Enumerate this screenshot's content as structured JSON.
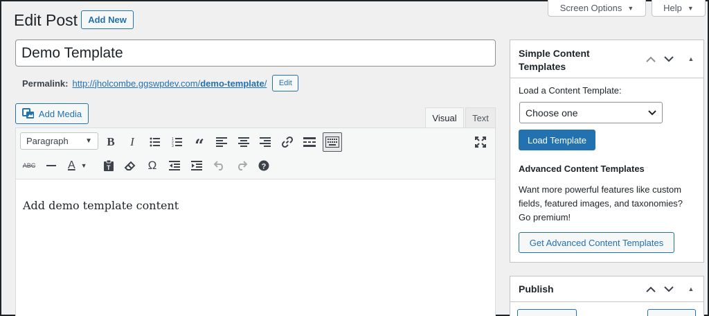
{
  "header": {
    "title": "Edit Post",
    "add_new_label": "Add New",
    "screen_options_label": "Screen Options",
    "help_label": "Help"
  },
  "post": {
    "title_value": "Demo Template",
    "permalink_label": "Permalink:",
    "permalink_base": "http://jholcombe.ggswpdev.com/",
    "permalink_slug": "demo-template",
    "permalink_trailing": "/",
    "edit_label": "Edit"
  },
  "editor": {
    "add_media_label": "Add Media",
    "tabs": [
      {
        "label": "Visual",
        "active": true
      },
      {
        "label": "Text",
        "active": false
      }
    ],
    "format_select": "Paragraph",
    "toolbar_row1_icons": [
      "bold-icon",
      "italic-icon",
      "bulleted-list-icon",
      "numbered-list-icon",
      "blockquote-icon",
      "align-left-icon",
      "align-center-icon",
      "align-right-icon",
      "link-icon",
      "read-more-icon",
      "toolbar-toggle-icon",
      "fullscreen-icon"
    ],
    "toolbar_row2_icons": [
      "strikethrough-icon",
      "horizontal-line-icon",
      "text-color-icon",
      "paste-as-text-icon",
      "clear-formatting-icon",
      "special-character-icon",
      "outdent-icon",
      "indent-icon",
      "undo-icon",
      "redo-icon",
      "help-icon"
    ],
    "content": "Add demo template content"
  },
  "sidebar": {
    "templates_box": {
      "title": "Simple Content Templates",
      "load_label": "Load a Content Template:",
      "select_value": "Choose one",
      "load_button": "Load Template",
      "advanced_heading": "Advanced Content Templates",
      "advanced_text_line1": "Want more powerful features like custom",
      "advanced_text_line2": "fields, featured images, and taxonomies?",
      "advanced_text_line3": "Go premium!",
      "advanced_button": "Get Advanced Content Templates"
    },
    "publish_box": {
      "title": "Publish"
    }
  },
  "colors": {
    "accent": "#2271b1",
    "background": "#f0f0f1"
  }
}
